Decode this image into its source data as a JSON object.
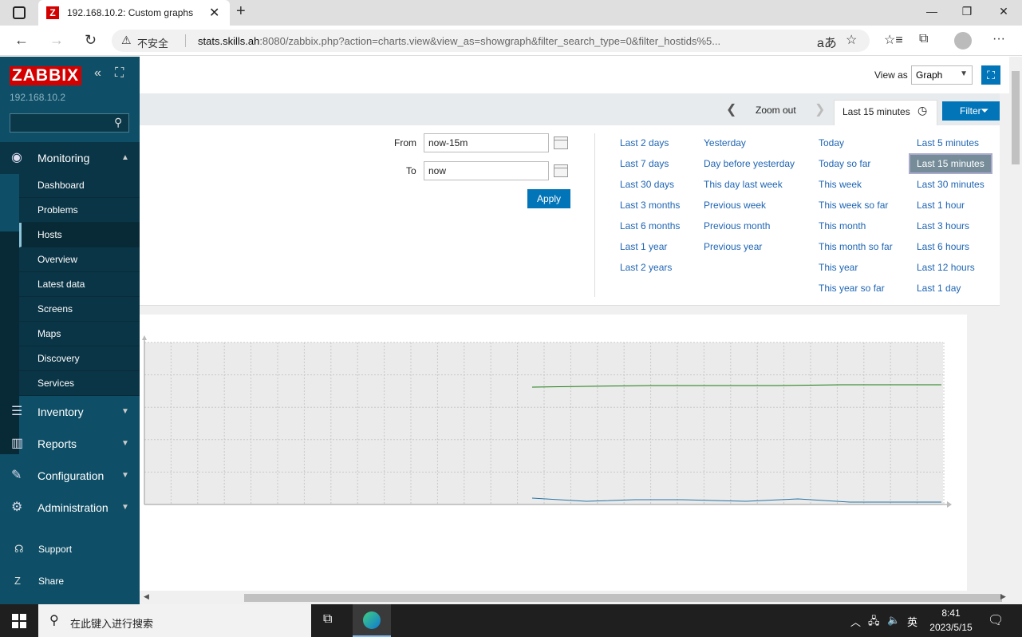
{
  "browser": {
    "tab_title": "192.168.10.2: Custom graphs",
    "tab_favicon": "Z",
    "insecure_label": "不安全",
    "url_host": "stats.skills.ah",
    "url_rest": ":8080/zabbix.php?action=charts.view&view_as=showgraph&filter_search_type=0&filter_hostids%5..."
  },
  "sidebar": {
    "logo": "ZABBIX",
    "server": "192.168.10.2",
    "search_placeholder": "",
    "monitoring_label": "Monitoring",
    "monitoring_items": [
      "Dashboard",
      "Problems",
      "Hosts",
      "Overview",
      "Latest data",
      "Screens",
      "Maps",
      "Discovery",
      "Services"
    ],
    "active_item": "Hosts",
    "inventory": "Inventory",
    "reports": "Reports",
    "configuration": "Configuration",
    "administration": "Administration",
    "support": "Support",
    "share": "Share"
  },
  "header": {
    "view_as_label": "View as",
    "view_as_value": "Graph"
  },
  "timebar": {
    "zoom_out": "Zoom out",
    "current_range": "Last 15 minutes",
    "filter_label": "Filter"
  },
  "filter": {
    "from_label": "From",
    "from_value": "now-15m",
    "to_label": "To",
    "to_value": "now",
    "apply_label": "Apply",
    "quick_ranges": {
      "col1": [
        "Last 2 days",
        "Last 7 days",
        "Last 30 days",
        "Last 3 months",
        "Last 6 months",
        "Last 1 year",
        "Last 2 years"
      ],
      "col2": [
        "Yesterday",
        "Day before yesterday",
        "This day last week",
        "Previous week",
        "Previous month",
        "Previous year"
      ],
      "col3": [
        "Today",
        "Today so far",
        "This week",
        "This week so far",
        "This month",
        "This month so far",
        "This year",
        "This year so far"
      ],
      "col4": [
        "Last 5 minutes",
        "Last 15 minutes",
        "Last 30 minutes",
        "Last 1 hour",
        "Last 3 hours",
        "Last 6 hours",
        "Last 12 hours",
        "Last 1 day"
      ]
    },
    "selected_range": "Last 15 minutes"
  },
  "graph": {
    "series_colors": [
      "#1a7c11",
      "#2774a4"
    ]
  },
  "taskbar": {
    "search_text": "在此键入进行搜索",
    "ime": "英",
    "time": "8:41",
    "date": "2023/5/15"
  }
}
